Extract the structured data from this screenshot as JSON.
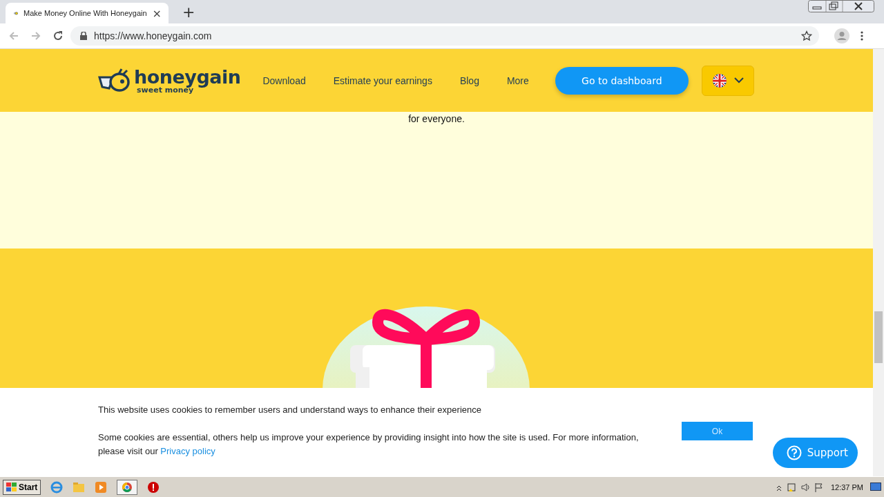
{
  "browser": {
    "tab": {
      "title": "Make Money Online With Honeygain",
      "close": "×"
    },
    "new_tab": "+",
    "url": "https://www.honeygain.com"
  },
  "header": {
    "logo": "honeygain",
    "tagline": "sweet money",
    "nav": [
      "Download",
      "Estimate your earnings",
      "Blog",
      "More"
    ],
    "cta": "Go to dashboard"
  },
  "intro_text": "for everyone.",
  "cookie": {
    "line1": "This website uses cookies to remember users and understand ways to enhance their experience",
    "line2": "Some cookies are essential, others help us improve your experience by providing insight into how the site is used. For more information, please visit our",
    "link": "Privacy policy",
    "button": "Ok"
  },
  "support": "Support",
  "taskbar": {
    "start": "Start",
    "clock": "12:37 PM"
  }
}
